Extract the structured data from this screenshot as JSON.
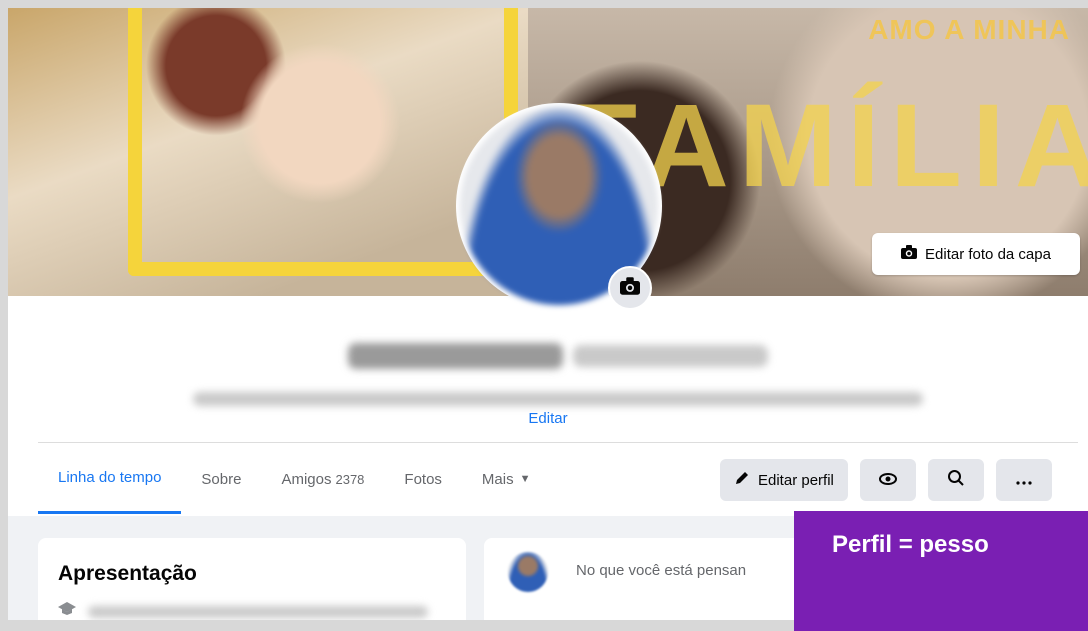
{
  "cover": {
    "text_small": "AMO A MINHA",
    "text_big": "FAMÍLIA",
    "edit_cover_label": "Editar foto da capa"
  },
  "profile": {
    "edit_link": "Editar"
  },
  "tabs": [
    {
      "label": "Linha do tempo",
      "active": true
    },
    {
      "label": "Sobre"
    },
    {
      "label": "Amigos",
      "count": "2378"
    },
    {
      "label": "Fotos"
    },
    {
      "label": "Mais"
    }
  ],
  "actions": {
    "edit_profile": "Editar perfil"
  },
  "intro": {
    "title": "Apresentação"
  },
  "composer": {
    "placeholder": "No que você está pensan"
  },
  "banner": {
    "text": "Perfil = pesso"
  },
  "colors": {
    "accent": "#1877f2",
    "banner": "#7a1fb3"
  }
}
